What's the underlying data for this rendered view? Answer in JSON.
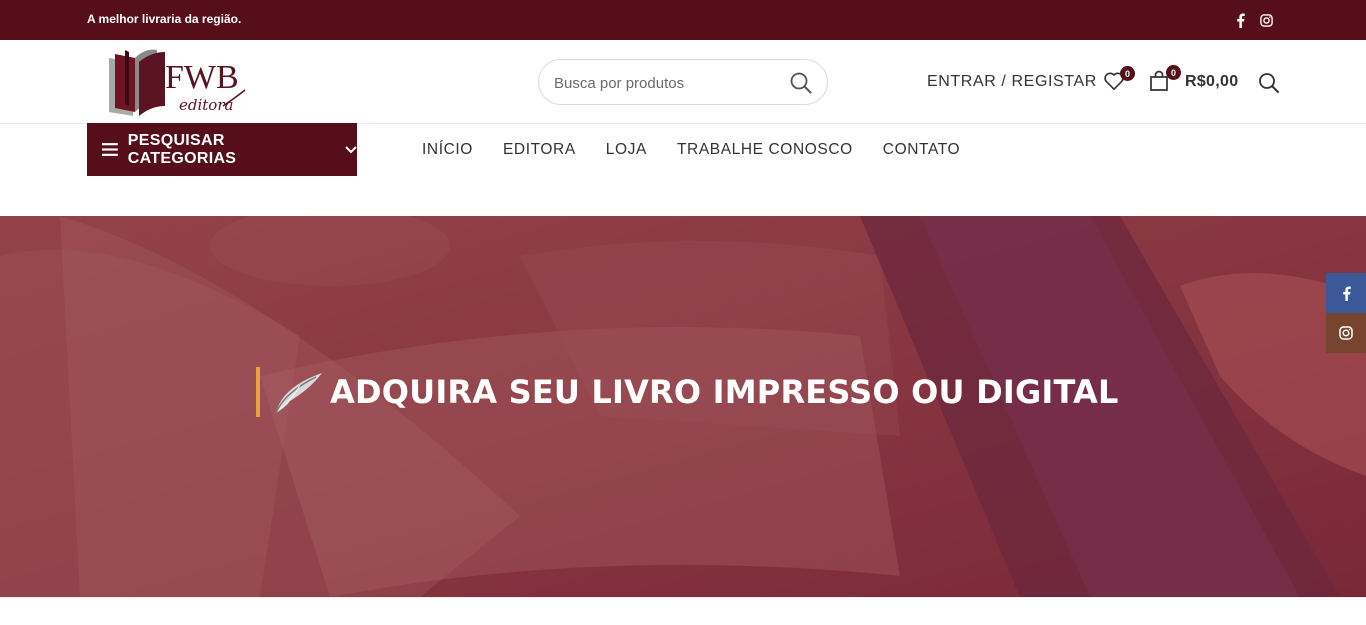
{
  "topbar": {
    "tagline": "A melhor livraria da região.",
    "social": [
      "facebook-icon",
      "instagram-icon"
    ]
  },
  "header": {
    "logo_text": "FWB",
    "logo_subtext": "editora",
    "search_placeholder": "Busca por produtos",
    "login_label": "ENTRAR / REGISTAR",
    "wishlist_count": "0",
    "cart_count": "0",
    "cart_total": "R$0,00"
  },
  "nav": {
    "categories_label": "PESQUISAR CATEGORIAS",
    "menu": [
      {
        "label": "INÍCIO"
      },
      {
        "label": "EDITORA"
      },
      {
        "label": "LOJA"
      },
      {
        "label": "TRABALHE CONOSCO"
      },
      {
        "label": "CONTATO"
      }
    ]
  },
  "hero": {
    "title": "ADQUIRA SEU LIVRO IMPRESSO OU DIGITAL"
  },
  "colors": {
    "brand": "#560f1a",
    "accent": "#e8a33c",
    "facebook": "#3b5998",
    "instagram": "#774430"
  }
}
